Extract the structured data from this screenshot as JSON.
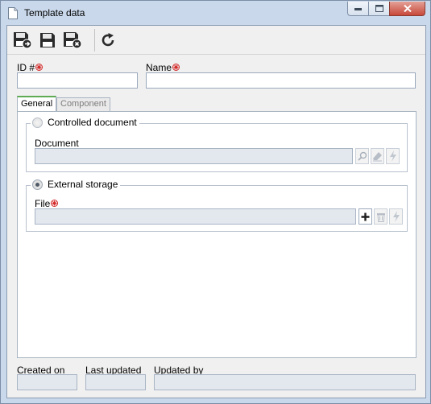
{
  "window": {
    "title": "Template data",
    "icons": {
      "app": "document-icon",
      "minimize": "minimize-icon",
      "maximize": "maximize-icon",
      "close": "close-icon"
    }
  },
  "toolbar": {
    "buttons": [
      {
        "name": "save-and-new",
        "icon": "save-and-new-icon"
      },
      {
        "name": "save",
        "icon": "save-icon"
      },
      {
        "name": "save-and-close",
        "icon": "save-and-close-icon"
      },
      {
        "name": "refresh",
        "icon": "refresh-icon"
      }
    ]
  },
  "form": {
    "id_label": "ID #",
    "id_value": "",
    "name_label": "Name",
    "name_value": ""
  },
  "tabs": [
    {
      "label": "General",
      "active": true
    },
    {
      "label": "Component",
      "active": false
    }
  ],
  "general": {
    "controlled_document": {
      "label": "Controlled document",
      "selected": false,
      "field_label": "Document",
      "field_value": ""
    },
    "external_storage": {
      "label": "External storage",
      "selected": true,
      "field_label": "File",
      "field_value": ""
    }
  },
  "footer": {
    "created_on_label": "Created on",
    "created_on_value": "",
    "last_updated_label": "Last updated",
    "last_updated_value": "",
    "updated_by_label": "Updated by",
    "updated_by_value": ""
  },
  "colors": {
    "frame": "#c9d8ea",
    "active_tab_accent": "#5fab54",
    "required_marker": "#d42a2a",
    "disabled_field": "#e3e8ef"
  }
}
